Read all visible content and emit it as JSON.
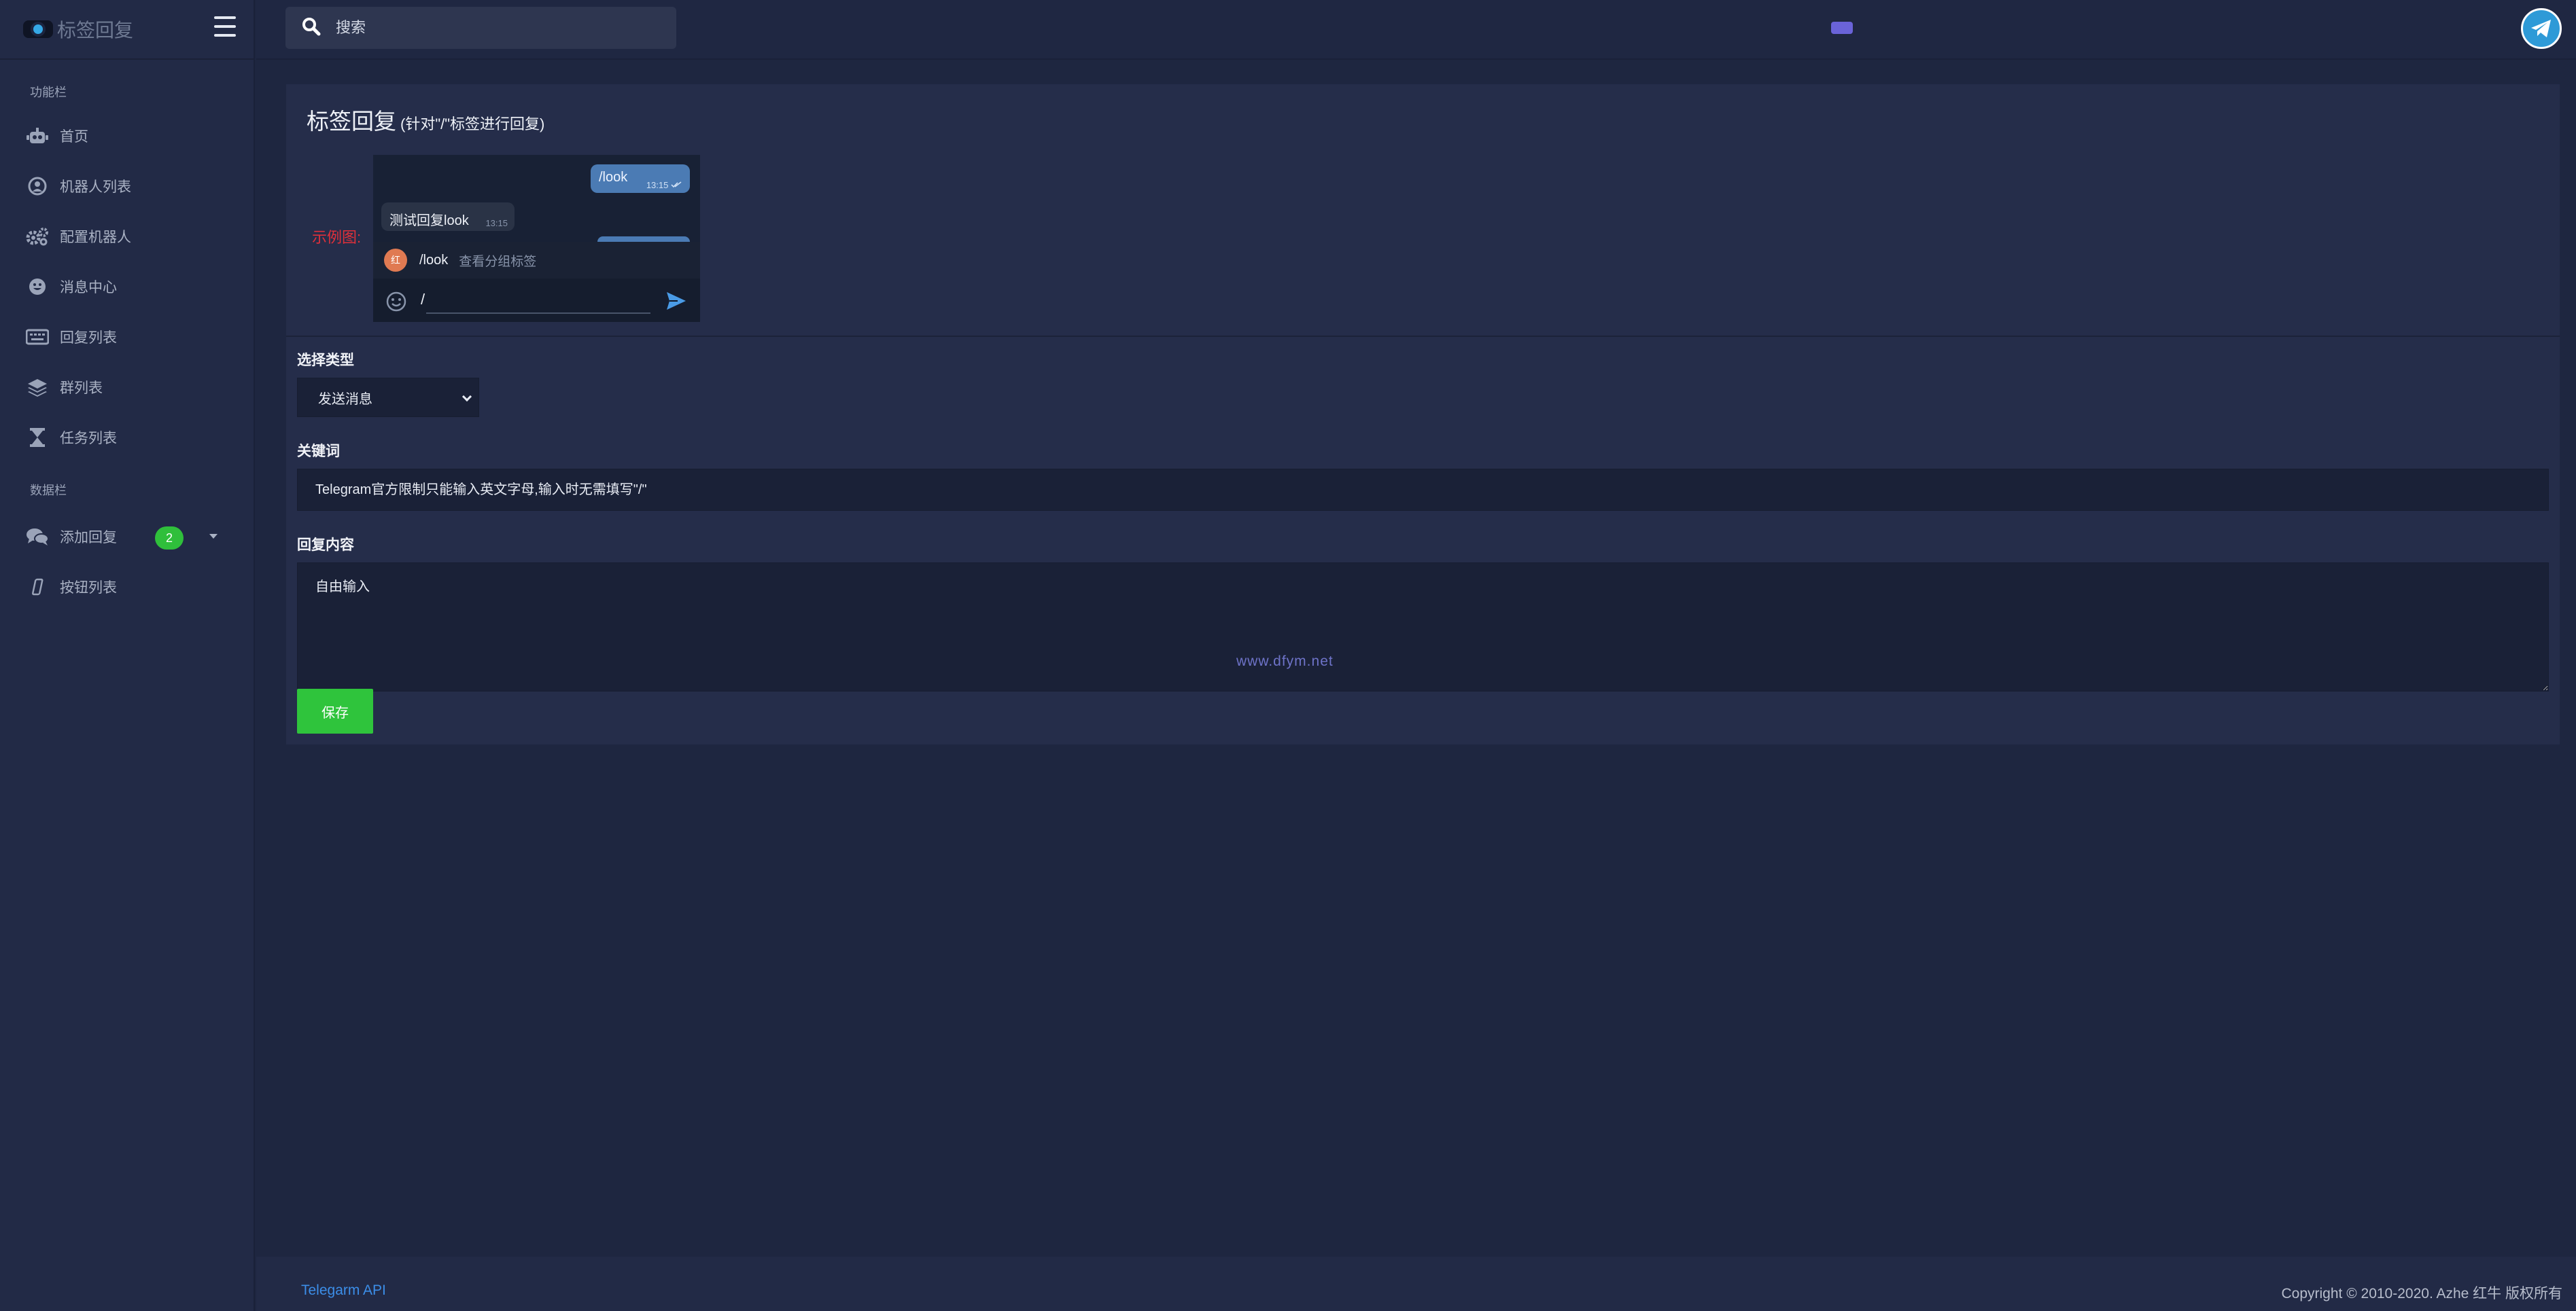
{
  "sidebar": {
    "brand_title": "标签回复",
    "section_functions": "功能栏",
    "section_data": "数据栏",
    "items": [
      {
        "label": "首页",
        "icon": "robot-icon"
      },
      {
        "label": "机器人列表",
        "icon": "user-circle-icon"
      },
      {
        "label": "配置机器人",
        "icon": "gears-icon"
      },
      {
        "label": "消息中心",
        "icon": "face-icon"
      },
      {
        "label": "回复列表",
        "icon": "keyboard-icon"
      },
      {
        "label": "群列表",
        "icon": "layers-icon"
      },
      {
        "label": "任务列表",
        "icon": "hourglass-icon"
      },
      {
        "label": "添加回复",
        "icon": "comments-icon",
        "badge": "2"
      },
      {
        "label": "按钮列表",
        "icon": "mobile-icon"
      }
    ]
  },
  "topbar": {
    "search_placeholder": "搜索"
  },
  "card": {
    "title": "标签回复",
    "subtitle": "(针对\"/\"标签进行回复)",
    "example_label": "示例图:",
    "example": {
      "out_msg": "/look",
      "out_time": "13:15",
      "in_msg": "测试回复look",
      "in_time": "13:15",
      "cmd_avatar": "红",
      "cmd_name": "/look",
      "cmd_desc": "查看分组标签",
      "input_text": "/"
    },
    "type_label": "选择类型",
    "type_selected": "发送消息",
    "keyword_label": "关键词",
    "keyword_placeholder": "Telegram官方限制只能输入英文字母,输入时无需填写\"/\"",
    "content_label": "回复内容",
    "content_placeholder": "自由输入",
    "watermark": "www.dfym.net",
    "save_label": "保存"
  },
  "footer": {
    "link": "Telegarm API",
    "copyright": "Copyright © 2010-2020. Azhe 红牛 版权所有"
  },
  "colors": {
    "accent_green": "#2fc43c",
    "telegram_blue": "#2e9ad7",
    "warning_red": "#e0303a",
    "link_blue": "#3c8ee8"
  }
}
